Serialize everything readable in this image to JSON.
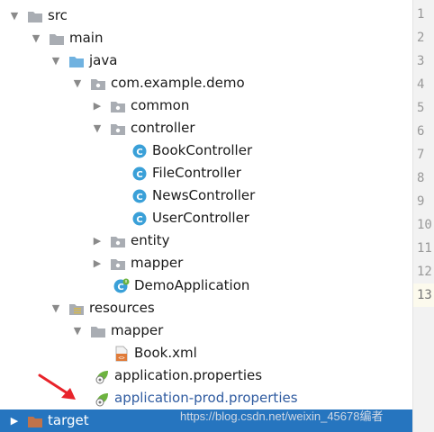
{
  "tree": {
    "items": [
      {
        "label": "src",
        "icon": "folder-icon",
        "expanded": true
      },
      {
        "label": "main",
        "icon": "folder-icon",
        "expanded": true
      },
      {
        "label": "java",
        "icon": "source-folder-icon",
        "expanded": true
      },
      {
        "label": "com.example.demo",
        "icon": "package-icon",
        "expanded": true
      },
      {
        "label": "common",
        "icon": "package-icon",
        "expanded": false
      },
      {
        "label": "controller",
        "icon": "package-icon",
        "expanded": true
      },
      {
        "label": "BookController",
        "icon": "java-class-icon"
      },
      {
        "label": "FileController",
        "icon": "java-class-icon"
      },
      {
        "label": "NewsController",
        "icon": "java-class-icon"
      },
      {
        "label": "UserController",
        "icon": "java-class-icon"
      },
      {
        "label": "entity",
        "icon": "package-icon",
        "expanded": false
      },
      {
        "label": "mapper",
        "icon": "package-icon",
        "expanded": false
      },
      {
        "label": "DemoApplication",
        "icon": "spring-boot-class-icon"
      },
      {
        "label": "resources",
        "icon": "resources-folder-icon",
        "expanded": true
      },
      {
        "label": "mapper",
        "icon": "folder-icon",
        "expanded": true
      },
      {
        "label": "Book.xml",
        "icon": "xml-file-icon"
      },
      {
        "label": "application.properties",
        "icon": "spring-properties-icon"
      },
      {
        "label": "application-prod.properties",
        "icon": "spring-properties-icon"
      },
      {
        "label": "target",
        "icon": "excluded-folder-icon",
        "expanded": false,
        "selected": true
      }
    ]
  },
  "gutter": {
    "line_numbers": [
      "1",
      "2",
      "3",
      "4",
      "5",
      "6",
      "7",
      "8",
      "9",
      "10",
      "11",
      "12",
      "13"
    ],
    "current_line": "13"
  },
  "watermark": "https://blog.csdn.net/weixin_45678编者",
  "colors": {
    "selection": "#2675bf",
    "folder": "#a9adb3",
    "source_folder": "#70b2e0",
    "class_icon": "#3aa0d8",
    "excluded_folder": "#c0734a",
    "annotation_arrow": "#e8232a"
  }
}
